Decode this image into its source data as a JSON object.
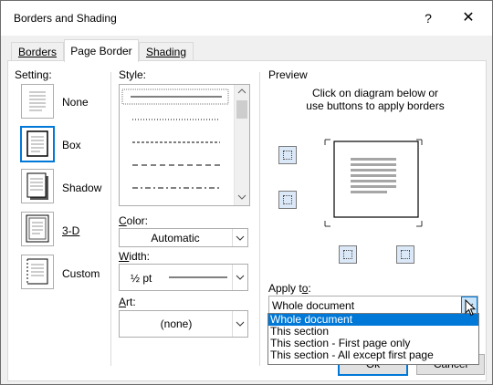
{
  "window": {
    "title": "Borders and Shading",
    "help": "?",
    "close": "✕"
  },
  "tabs": [
    {
      "label": "Borders"
    },
    {
      "label": "Page Border"
    },
    {
      "label": "Shading"
    }
  ],
  "setting": {
    "label": "Setting:",
    "items": [
      {
        "label": "None",
        "icon": "setting-none-icon"
      },
      {
        "label": "Box",
        "icon": "setting-box-icon",
        "selected": true
      },
      {
        "label": "Shadow",
        "icon": "setting-shadow-icon"
      },
      {
        "label": "3-D",
        "icon": "setting-3d-icon"
      },
      {
        "label": "Custom",
        "icon": "setting-custom-icon"
      }
    ]
  },
  "style": {
    "label": "Style:",
    "options": [
      "solid",
      "dotted",
      "dashed-small",
      "dashed-large",
      "dash-dot"
    ],
    "selected": "solid"
  },
  "color": {
    "label": "Color:",
    "value": "Automatic"
  },
  "width": {
    "label": "Width:",
    "value": "½ pt"
  },
  "art": {
    "label": "Art:",
    "value": "(none)"
  },
  "preview": {
    "label": "Preview",
    "instructions_line1": "Click on diagram below or",
    "instructions_line2": "use buttons to apply borders"
  },
  "apply_to": {
    "label": "Apply to:",
    "value": "Whole document",
    "options": [
      "Whole document",
      "This section",
      "This section - First page only",
      "This section - All except first page"
    ],
    "selected_index": 0
  },
  "buttons": {
    "ok": "Ok",
    "cancel": "Cancel"
  },
  "colors": {
    "accent": "#0078d7",
    "border": "#adadad"
  }
}
